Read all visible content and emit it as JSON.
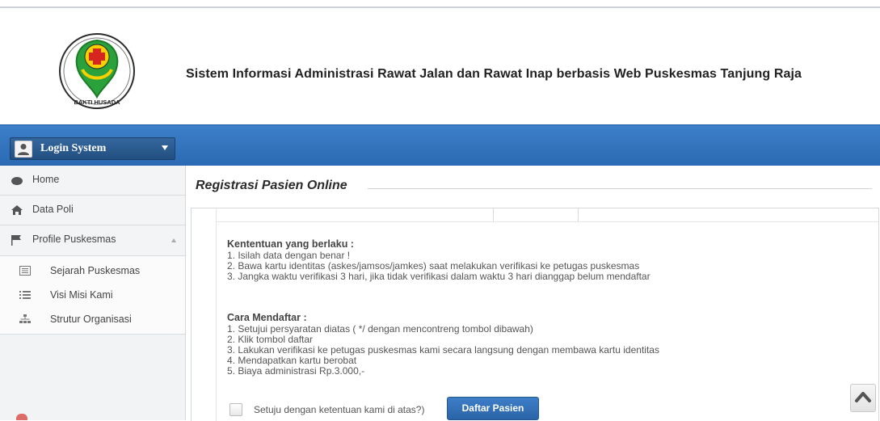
{
  "header": {
    "site_title": "Sistem Informasi Administrasi Rawat Jalan dan Rawat Inap berbasis Web Puskesmas Tanjung Raja",
    "logo_text": "BAKTI HUSADA",
    "logo_icon": "bakti-husada-logo"
  },
  "topbar": {
    "login_label": "Login System",
    "accent_color": "#2f6fb8"
  },
  "sidebar": {
    "items": [
      {
        "label": "Home",
        "icon": "home-icon"
      },
      {
        "label": "Data Poli",
        "icon": "house-icon"
      },
      {
        "label": "Profile Puskesmas",
        "icon": "flag-icon",
        "expanded": true
      }
    ],
    "subitems": [
      {
        "label": "Sejarah Puskesmas",
        "icon": "list-box-icon"
      },
      {
        "label": "Visi Misi Kami",
        "icon": "list-icon"
      },
      {
        "label": "Strutur Organisasi",
        "icon": "org-chart-icon"
      }
    ]
  },
  "main": {
    "title": "Registrasi Pasien Online",
    "rules": {
      "heading": "Kententuan yang berlaku :",
      "lines": [
        "1. Isilah data dengan benar !",
        "2. Bawa kartu identitas (askes/jamsos/jamkes) saat melakukan verifikasi ke petugas puskesmas",
        "3. Jangka waktu verifikasi 3 hari, jika tidak verifikasi dalam waktu 3 hari dianggap belum mendaftar"
      ]
    },
    "howto": {
      "heading": "Cara Mendaftar :",
      "lines": [
        "1. Setujui persyaratan diatas ( */ dengan mencontreng tombol dibawah)",
        "2. Klik tombol daftar",
        "3. Lakukan verifikasi ke petugas puskesmas kami secara langsung dengan membawa kartu identitas",
        "4. Mendapatkan kartu berobat",
        "5. Biaya administrasi Rp.3.000,-"
      ]
    },
    "agree_label": "Setuju dengan ketentuan kami di atas?)",
    "agree_checked": false,
    "register_button": "Daftar Pasien"
  }
}
